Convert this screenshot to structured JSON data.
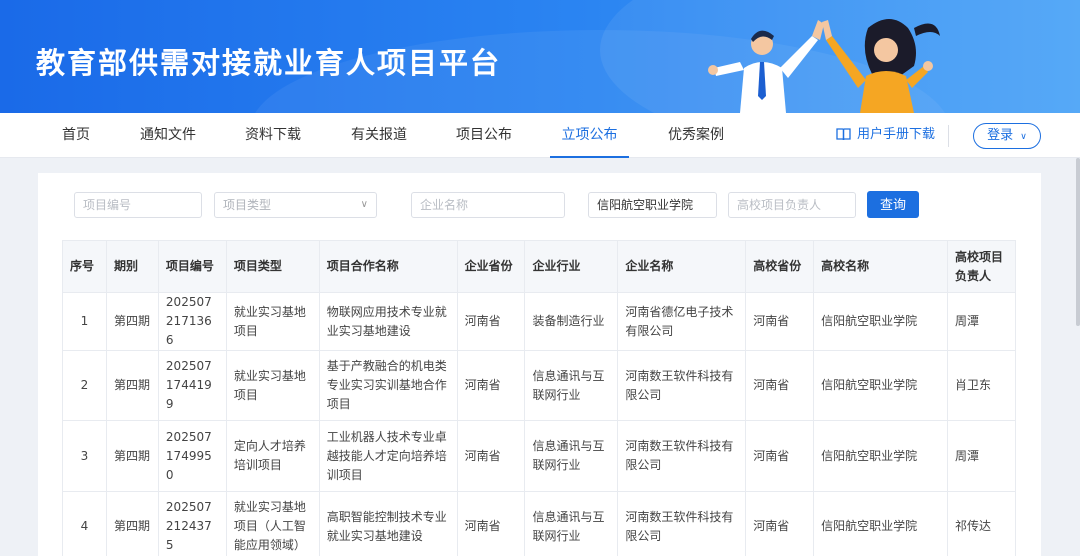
{
  "banner": {
    "title": "教育部供需对接就业育人项目平台"
  },
  "nav": {
    "items": [
      "首页",
      "通知文件",
      "资料下载",
      "有关报道",
      "项目公布",
      "立项公布",
      "优秀案例"
    ],
    "active_index": 5,
    "manual_label": "用户手册下载",
    "login_label": "登录"
  },
  "filters": {
    "project_no_placeholder": "项目编号",
    "project_type_placeholder": "项目类型",
    "company_name_placeholder": "企业名称",
    "school_value": "信阳航空职业学院",
    "school_lead_placeholder": "高校项目负责人",
    "query_label": "查询"
  },
  "table": {
    "headers": [
      "序号",
      "期别",
      "项目编号",
      "项目类型",
      "项目合作名称",
      "企业省份",
      "企业行业",
      "企业名称",
      "高校省份",
      "高校名称",
      "高校项目负责人"
    ],
    "rows": [
      [
        "1",
        "第四期",
        "2025072171366",
        "就业实习基地项目",
        "物联网应用技术专业就业实习基地建设",
        "河南省",
        "装备制造行业",
        "河南省德亿电子技术有限公司",
        "河南省",
        "信阳航空职业学院",
        "周潭"
      ],
      [
        "2",
        "第四期",
        "2025071744199",
        "就业实习基地项目",
        "基于产教融合的机电类专业实习实训基地合作项目",
        "河南省",
        "信息通讯与互联网行业",
        "河南数王软件科技有限公司",
        "河南省",
        "信阳航空职业学院",
        "肖卫东"
      ],
      [
        "3",
        "第四期",
        "2025071749950",
        "定向人才培养培训项目",
        "工业机器人技术专业卓越技能人才定向培养培训项目",
        "河南省",
        "信息通讯与互联网行业",
        "河南数王软件科技有限公司",
        "河南省",
        "信阳航空职业学院",
        "周潭"
      ],
      [
        "4",
        "第四期",
        "2025072124375",
        "就业实习基地项目（人工智能应用领域）",
        "高职智能控制技术专业就业实习基地建设",
        "河南省",
        "信息通讯与互联网行业",
        "河南数王软件科技有限公司",
        "河南省",
        "信阳航空职业学院",
        "祁传达"
      ]
    ]
  }
}
